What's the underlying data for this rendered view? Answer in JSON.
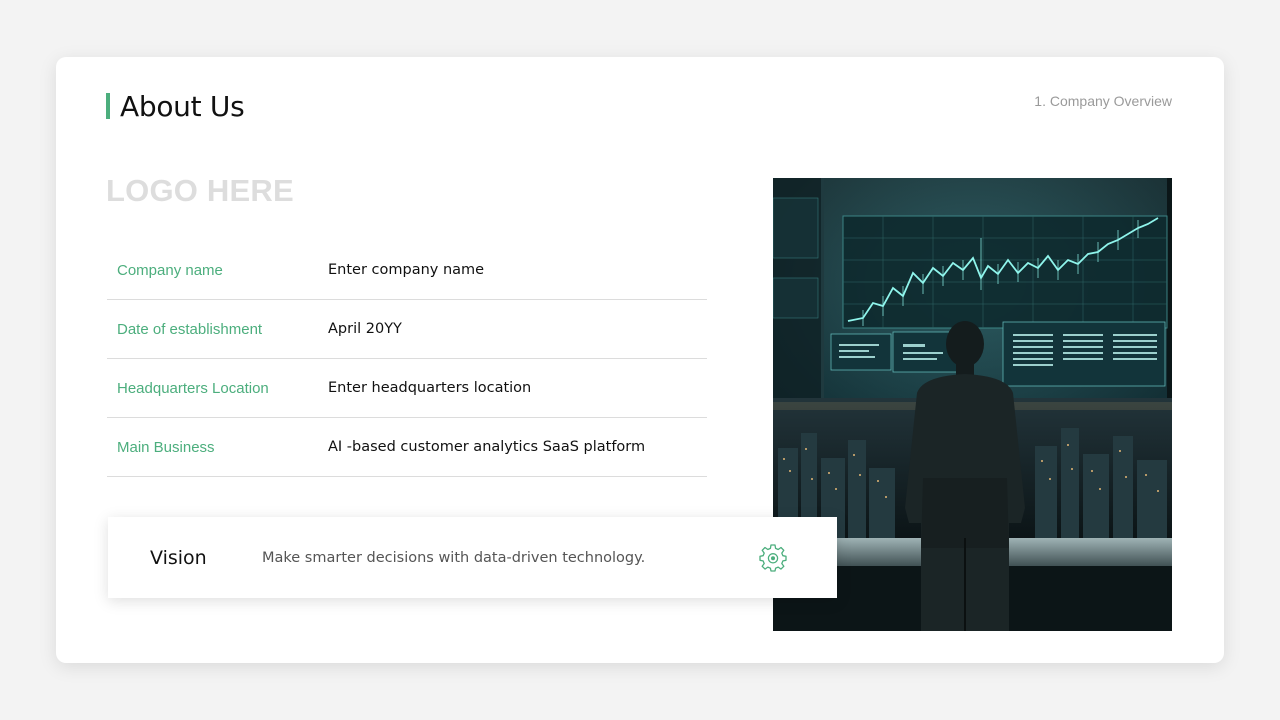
{
  "header": {
    "title": "About Us",
    "section": "1. Company Overview"
  },
  "logo_placeholder": "LOGO HERE",
  "info_rows": [
    {
      "label": "Company name",
      "value": "Enter company name"
    },
    {
      "label": "Date of establishment",
      "value": "April 20YY"
    },
    {
      "label": "Headquarters Location",
      "value": "Enter headquarters location"
    },
    {
      "label": "Main Business",
      "value": "AI -based customer analytics SaaS platform"
    }
  ],
  "vision": {
    "label": "Vision",
    "text": "Make smarter decisions with data-driven technology.",
    "icon": "gear-icon"
  },
  "photo": {
    "description_icon": "businessman-looking-at-stock-chart-image"
  },
  "colors": {
    "accent": "#4cae7d",
    "background": "#f3f3f3",
    "card": "#ffffff",
    "muted": "#9a9a9a",
    "logo_placeholder": "#dddddd"
  }
}
